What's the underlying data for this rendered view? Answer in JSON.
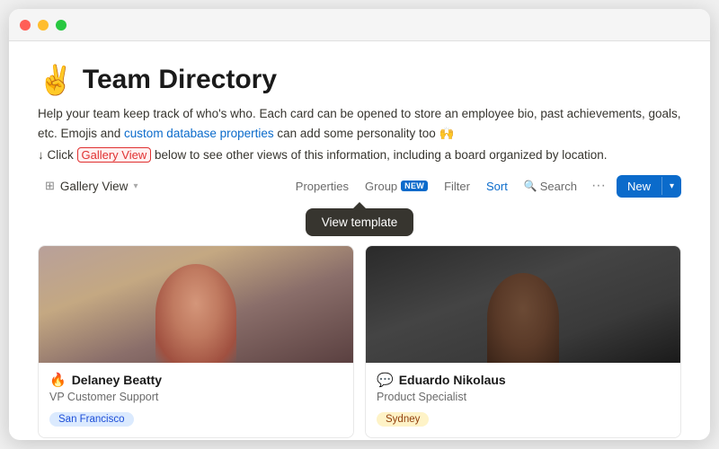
{
  "window": {
    "title": "Team Directory"
  },
  "trafficLights": {
    "red": "close",
    "yellow": "minimize",
    "green": "maximize"
  },
  "page": {
    "emoji": "✌️",
    "title": "Team Directory",
    "description": "Help your team keep track of who's who. Each card can be opened to store an employee bio, past achievements, goals, etc. Emojis and custom database properties can add some personality too 🙌",
    "description_link": "custom database properties",
    "click_hint_prefix": "↓ Click ",
    "gallery_view_label": "Gallery View",
    "click_hint_suffix": " below to see other views of this information, including a board organized by location."
  },
  "toolbar": {
    "view_icon": "⊞",
    "view_label": "Gallery View",
    "chevron": "▾",
    "properties_label": "Properties",
    "group_label": "Group",
    "group_badge": "NEW",
    "filter_label": "Filter",
    "sort_label": "Sort",
    "search_label": "Search",
    "dots_label": "···",
    "new_label": "New",
    "new_arrow": "▾"
  },
  "tooltip": {
    "label": "View template"
  },
  "cards": [
    {
      "emoji": "🔥",
      "name": "Delaney Beatty",
      "role": "VP Customer Support",
      "tag": "San Francisco",
      "tag_class": "tag-sf",
      "photo_class": "photo-delaney",
      "face_class": "face-delaney"
    },
    {
      "emoji": "💬",
      "name": "Eduardo Nikolaus",
      "role": "Product Specialist",
      "tag": "Sydney",
      "tag_class": "tag-sydney",
      "photo_class": "photo-eduardo",
      "face_class": "face-eduardo"
    }
  ]
}
